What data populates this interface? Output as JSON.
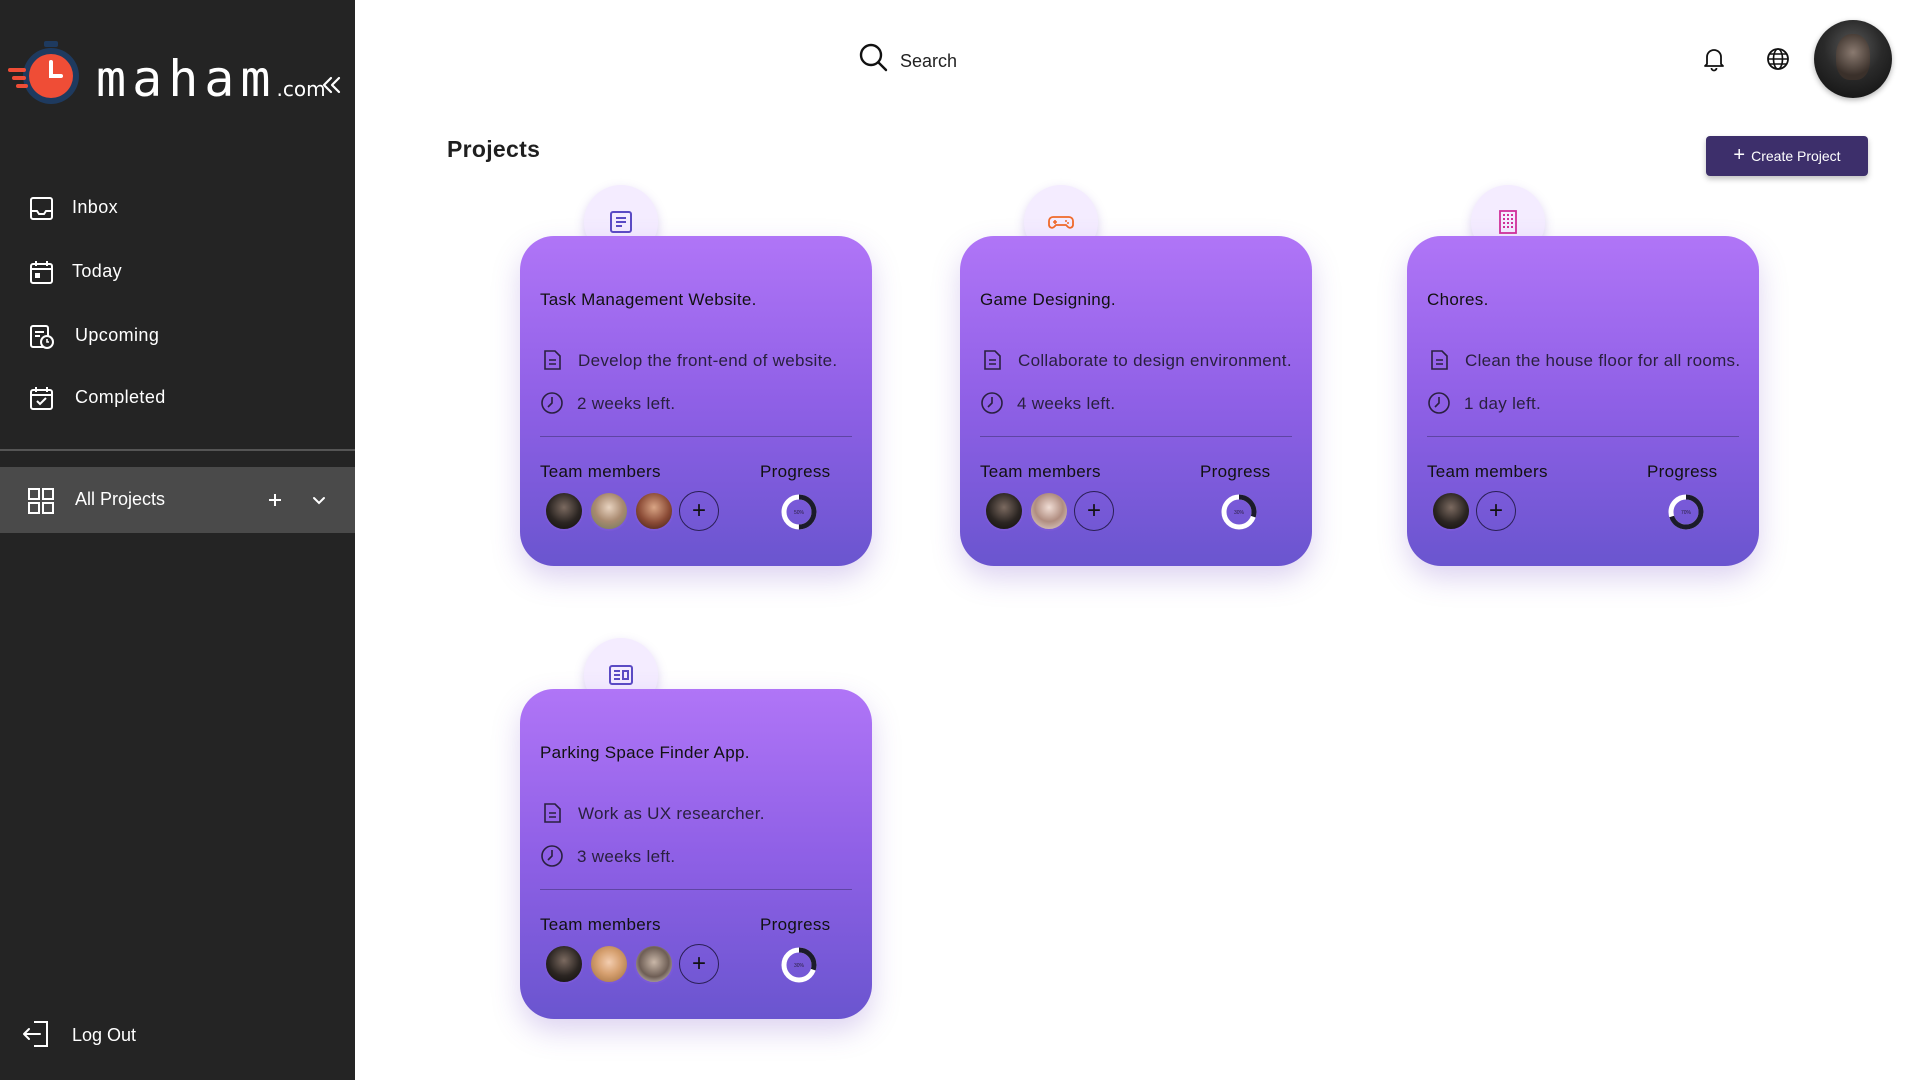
{
  "brand": {
    "name": "maham",
    "suffix": ".com"
  },
  "sidebar": {
    "items": [
      {
        "label": "Inbox",
        "icon": "inbox-icon"
      },
      {
        "label": "Today",
        "icon": "calendar-icon"
      },
      {
        "label": "Upcoming",
        "icon": "calendar-clock-icon"
      },
      {
        "label": "Completed",
        "icon": "calendar-check-icon"
      }
    ],
    "all_projects": {
      "label": "All Projects",
      "icon": "grid-icon"
    },
    "logout": {
      "label": "Log Out",
      "icon": "logout-icon"
    }
  },
  "header": {
    "search_label": "Search"
  },
  "page": {
    "title": "Projects",
    "create_button": "Create Project"
  },
  "colors": {
    "sidebar_bg": "#242424",
    "active_item": "#4a4a4a",
    "card_top": "#b075f7",
    "card_bottom": "#6a55cf",
    "button": "#3d2f6b"
  },
  "projects": [
    {
      "title": "Task Management Website.",
      "icon": "document-list-icon",
      "task": "Develop the front-end of website.",
      "time_left": "2 weeks left.",
      "team_label": "Team members",
      "progress_label": "Progress",
      "progress": 0.5,
      "progress_text": "50%",
      "member_count": 3
    },
    {
      "title": "Game Designing.",
      "icon": "gamepad-icon",
      "task": "Collaborate to design environment.",
      "time_left": "4 weeks left.",
      "team_label": "Team members",
      "progress_label": "Progress",
      "progress": 0.3,
      "progress_text": "30%",
      "member_count": 2
    },
    {
      "title": "Chores.",
      "icon": "building-icon",
      "task": "Clean the house floor for all rooms.",
      "time_left": "1 day left.",
      "team_label": "Team members",
      "progress_label": "Progress",
      "progress": 0.7,
      "progress_text": "70%",
      "member_count": 1
    },
    {
      "title": "Parking Space Finder App.",
      "icon": "newspaper-icon",
      "task": "Work as UX researcher.",
      "time_left": "3 weeks left.",
      "team_label": "Team members",
      "progress_label": "Progress",
      "progress": 0.3,
      "progress_text": "30%",
      "member_count": 3
    }
  ]
}
